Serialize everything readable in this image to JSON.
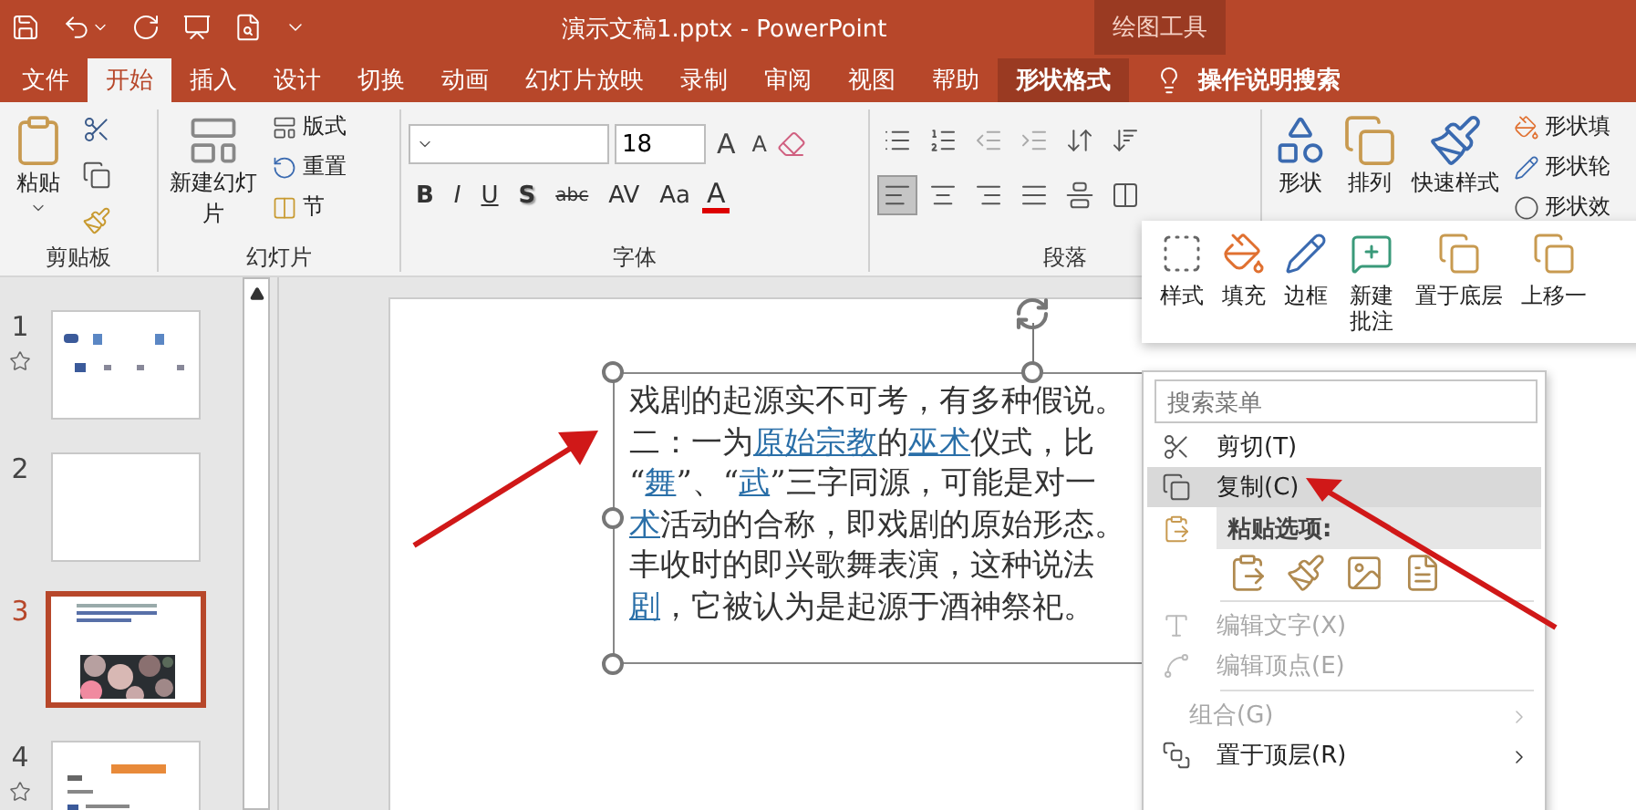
{
  "window": {
    "title": "演示文稿1.pptx  -  PowerPoint",
    "context_title": "绘图工具"
  },
  "tabs": [
    {
      "label": "文件",
      "selected": false,
      "kind": "normal"
    },
    {
      "label": "开始",
      "selected": true,
      "kind": "normal"
    },
    {
      "label": "插入",
      "selected": false,
      "kind": "normal"
    },
    {
      "label": "设计",
      "selected": false,
      "kind": "normal"
    },
    {
      "label": "切换",
      "selected": false,
      "kind": "normal"
    },
    {
      "label": "动画",
      "selected": false,
      "kind": "normal"
    },
    {
      "label": "幻灯片放映",
      "selected": false,
      "kind": "normal"
    },
    {
      "label": "录制",
      "selected": false,
      "kind": "normal"
    },
    {
      "label": "审阅",
      "selected": false,
      "kind": "normal"
    },
    {
      "label": "视图",
      "selected": false,
      "kind": "normal"
    },
    {
      "label": "帮助",
      "selected": false,
      "kind": "normal"
    },
    {
      "label": "形状格式",
      "selected": false,
      "kind": "contextual"
    }
  ],
  "tell_me": {
    "label": "操作说明搜索"
  },
  "ribbon": {
    "clipboard": {
      "title": "剪贴板",
      "paste": "粘贴"
    },
    "slides": {
      "title": "幻灯片",
      "new_slide": "新建幻灯片",
      "layout": "版式",
      "reset": "重置",
      "section": "节"
    },
    "font": {
      "title": "字体",
      "font_size": "18",
      "grow": "A",
      "shrink": "A",
      "color_label": "A",
      "styles": [
        {
          "label": "B",
          "kind": "bold"
        },
        {
          "label": "I",
          "kind": "italic"
        },
        {
          "label": "U",
          "kind": "underline"
        },
        {
          "label": "S",
          "kind": "shadow"
        },
        {
          "label": "abc",
          "kind": "strike"
        },
        {
          "label": "AV",
          "kind": "spacing"
        },
        {
          "label": "Aa",
          "kind": "case"
        }
      ]
    },
    "paragraph": {
      "title": "段落",
      "alignments": [
        {
          "selected": true
        },
        {
          "selected": false
        },
        {
          "selected": false
        },
        {
          "selected": false
        },
        {
          "selected": false
        }
      ]
    },
    "drawing": {
      "shapes": "形状",
      "arrange": "排列",
      "quick_styles": "快速样式",
      "fill": "形状填",
      "outline": "形状轮",
      "effects": "形状效"
    }
  },
  "slides": [
    {
      "number": "1",
      "starred": true,
      "selected": false,
      "kind": "title"
    },
    {
      "number": "2",
      "starred": false,
      "selected": false,
      "kind": "blank"
    },
    {
      "number": "3",
      "starred": false,
      "selected": true,
      "kind": "picture"
    },
    {
      "number": "4",
      "starred": true,
      "selected": false,
      "kind": "text"
    }
  ],
  "text_box": {
    "lines": [
      [
        {
          "text": "戏剧的起源实不可考，有多种假说。",
          "link": false
        }
      ],
      [
        {
          "text": "二：一为",
          "link": false
        },
        {
          "text": "原始宗教",
          "link": true
        },
        {
          "text": "的",
          "link": false
        },
        {
          "text": "巫术",
          "link": true
        },
        {
          "text": "仪式，比",
          "link": false
        }
      ],
      [
        {
          "text": "“",
          "link": false
        },
        {
          "text": "舞",
          "link": true
        },
        {
          "text": "”、“",
          "link": false
        },
        {
          "text": "武",
          "link": true
        },
        {
          "text": "”三字同源，可能是对一",
          "link": false
        }
      ],
      [
        {
          "text": "术",
          "link": true
        },
        {
          "text": "活动的合称，即戏剧的原始形态。",
          "link": false
        }
      ],
      [
        {
          "text": "丰收时的即兴歌舞表演，这种说法",
          "link": false
        }
      ],
      [
        {
          "text": "剧",
          "link": true
        },
        {
          "text": "，它被认为是起源于酒神祭祀。",
          "link": false
        }
      ]
    ]
  },
  "mini_toolbar": [
    {
      "label": "样式"
    },
    {
      "label": "填充"
    },
    {
      "label": "边框"
    },
    {
      "label": "新建批注"
    },
    {
      "label": "置于底层"
    },
    {
      "label": "上移一"
    }
  ],
  "context_menu": {
    "search": {
      "placeholder": "搜索菜单"
    },
    "items": [
      {
        "kind": "item",
        "label": "剪切(T)",
        "selected": false,
        "disabled": false,
        "submenu": false
      },
      {
        "kind": "item",
        "label": "复制(C)",
        "selected": true,
        "disabled": false,
        "submenu": false
      },
      {
        "kind": "header",
        "label": "粘贴选项:"
      },
      {
        "kind": "paste_options"
      },
      {
        "kind": "separator"
      },
      {
        "kind": "item",
        "label": "编辑文字(X)",
        "selected": false,
        "disabled": true,
        "submenu": false
      },
      {
        "kind": "item",
        "label": "编辑顶点(E)",
        "selected": false,
        "disabled": true,
        "submenu": false
      },
      {
        "kind": "separator"
      },
      {
        "kind": "item",
        "label": "组合(G)",
        "selected": false,
        "disabled": true,
        "submenu": true
      },
      {
        "kind": "item",
        "label": "置于顶层(R)",
        "selected": false,
        "disabled": false,
        "submenu": true
      }
    ]
  }
}
